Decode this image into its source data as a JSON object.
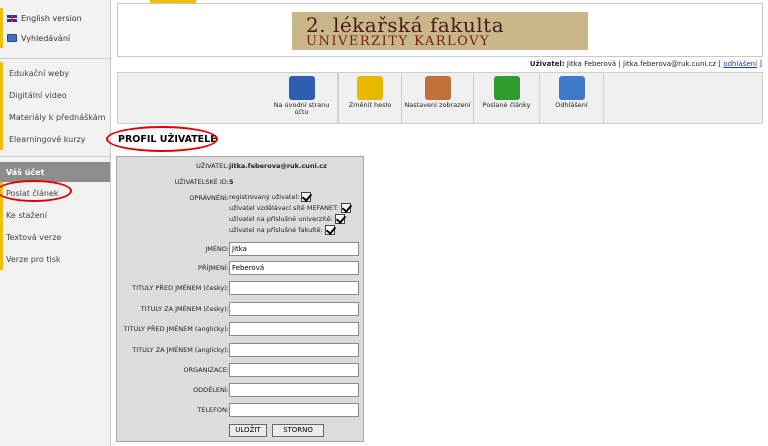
{
  "sidebar": {
    "top_items": [
      {
        "label": "English version",
        "icon": "uk-flag-icon"
      },
      {
        "label": "Vyhledávání",
        "icon": "search-icon"
      }
    ],
    "mid_items": [
      "Edukační weby",
      "Digitální video",
      "Materiály k přednáškám",
      "Elearningové kurzy"
    ],
    "account_header": "Váš účet",
    "account_items": [
      "Poslat článek",
      "Ke stažení",
      "Textová verze",
      "Verze pro tisk"
    ]
  },
  "banner": {
    "line1": "2. lékařská fakulta",
    "line2": "UNIVERZITY KARLOVY"
  },
  "userline": {
    "label": "Uživatel:",
    "name": "Jitka Feberová",
    "separator": "|",
    "email": "jitka.feberova@ruk.cuni.cz",
    "logout": "odhlášení"
  },
  "toolbar": [
    {
      "label": "Na úvodní stranu účtu",
      "icon": "home-magnifier-icon",
      "color": "#2c5fb0"
    },
    {
      "label": "Změnit heslo",
      "icon": "padlock-icon",
      "color": "#e8b800"
    },
    {
      "label": "Nastavení zobrazení",
      "icon": "clipboard-settings-icon",
      "color": "#c0703a"
    },
    {
      "label": "Poslané články",
      "icon": "linked-chain-icon",
      "color": "#2f9a2f"
    },
    {
      "label": "Odhlášení",
      "icon": "back-arrow-icon",
      "color": "#3f78c8"
    }
  ],
  "page_title": "PROFIL UŽIVATELE",
  "profile": {
    "user_label": "UŽIVATEL:",
    "user_value": "jitka.feberova@ruk.cuni.cz",
    "id_label": "UŽIVATELSKÉ ID:",
    "id_value": "5",
    "perm_label": "OPRÁVNĚNÍ:",
    "permissions": [
      "registrovaný uživatel:",
      "uživatel vzdělávací sítě MEFANET:",
      "uživatel na příslušné univerzitě:",
      "uživatel na příslušné fakultě:"
    ],
    "fields": [
      {
        "label": "JMÉNO:",
        "value": "Jitka"
      },
      {
        "label": "PŘÍJMENÍ:",
        "value": "Feberová"
      },
      {
        "label": "TITULY PŘED JMÉNEM (česky):",
        "value": ""
      },
      {
        "label": "TITULY ZA JMÉNEM (česky):",
        "value": ""
      },
      {
        "label": "TITULY PŘED JMÉNEM (anglicky):",
        "value": ""
      },
      {
        "label": "TITULY ZA JMÉNEM (anglicky):",
        "value": ""
      },
      {
        "label": "ORGANIZACE:",
        "value": ""
      },
      {
        "label": "ODDĚLENÍ:",
        "value": ""
      },
      {
        "label": "TELEFON:",
        "value": ""
      }
    ],
    "save_label": "ULOŽIT",
    "cancel_label": "STORNO"
  },
  "colors": {
    "accent": "#f0c000",
    "highlight_ring": "#e00000",
    "sidebar_header": "#8d8d8d"
  }
}
